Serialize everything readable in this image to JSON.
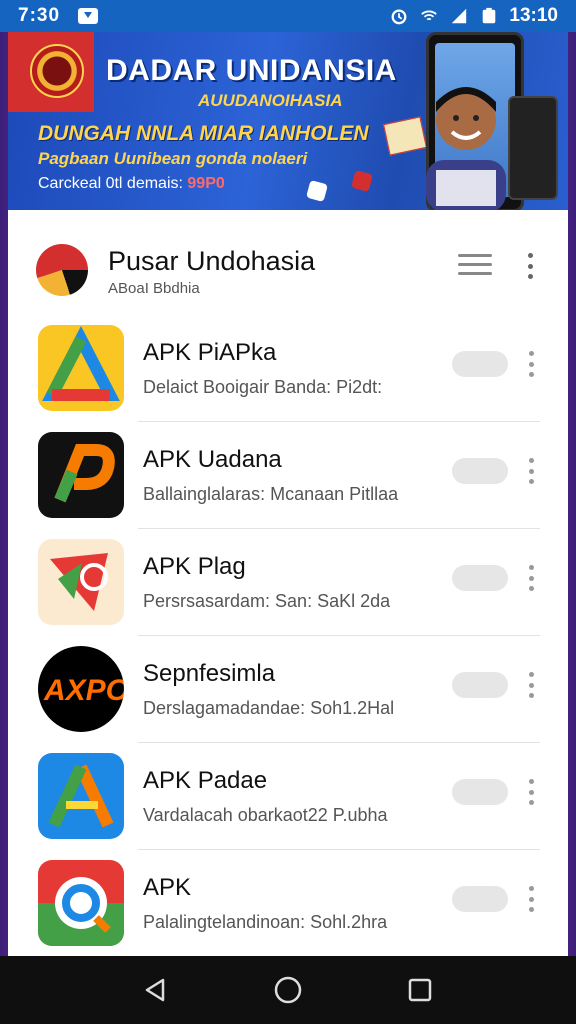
{
  "statusbar": {
    "time": "7:30",
    "clock_right": "13:10",
    "icons": [
      "notification-icon",
      "alarm-icon",
      "wifi-icon",
      "signal-icon",
      "battery-icon"
    ]
  },
  "banner": {
    "title": "DADAR UNIDANSIA",
    "subtitle": "AUUDANOIHASIA",
    "headline": "DUNGAH NNLA MIAR IANHOLEN",
    "tagline": "Pagbaan Uunibean gonda nolaeri",
    "cta_text": "Carckeal 0tl demais:",
    "cta_code": "99P0"
  },
  "header": {
    "name": "Pusar Undohasia",
    "sub": "ABoaI Bbdhia"
  },
  "apps": [
    {
      "title": "APK PiAPka",
      "desc": "Delaict Booigair Banda: Pi2dt:",
      "icon": "triangle-logo-icon"
    },
    {
      "title": "APK Uadana",
      "desc": "Ballainglalaras: Mcanaan Pitllaa",
      "icon": "p-logo-icon"
    },
    {
      "title": "APK Plag",
      "desc": "Persrsasardam: San: SaKl 2da",
      "icon": "play-logo-icon"
    },
    {
      "title": "Sepnfesimla",
      "desc": "Derslagamadandae: Soh1.2Hal",
      "icon": "apo-logo-icon"
    },
    {
      "title": "APK Padae",
      "desc": "Vardalacah obarkaot22 P.ubha",
      "icon": "a-logo-icon"
    },
    {
      "title": "APK",
      "desc": "Palalingtelandinoan: Sohl.2hra",
      "icon": "ring-logo-icon"
    }
  ],
  "colors": {
    "statusbar": "#1565c0",
    "banner": "#2c63d6",
    "accent_yellow": "#ffd54f"
  }
}
